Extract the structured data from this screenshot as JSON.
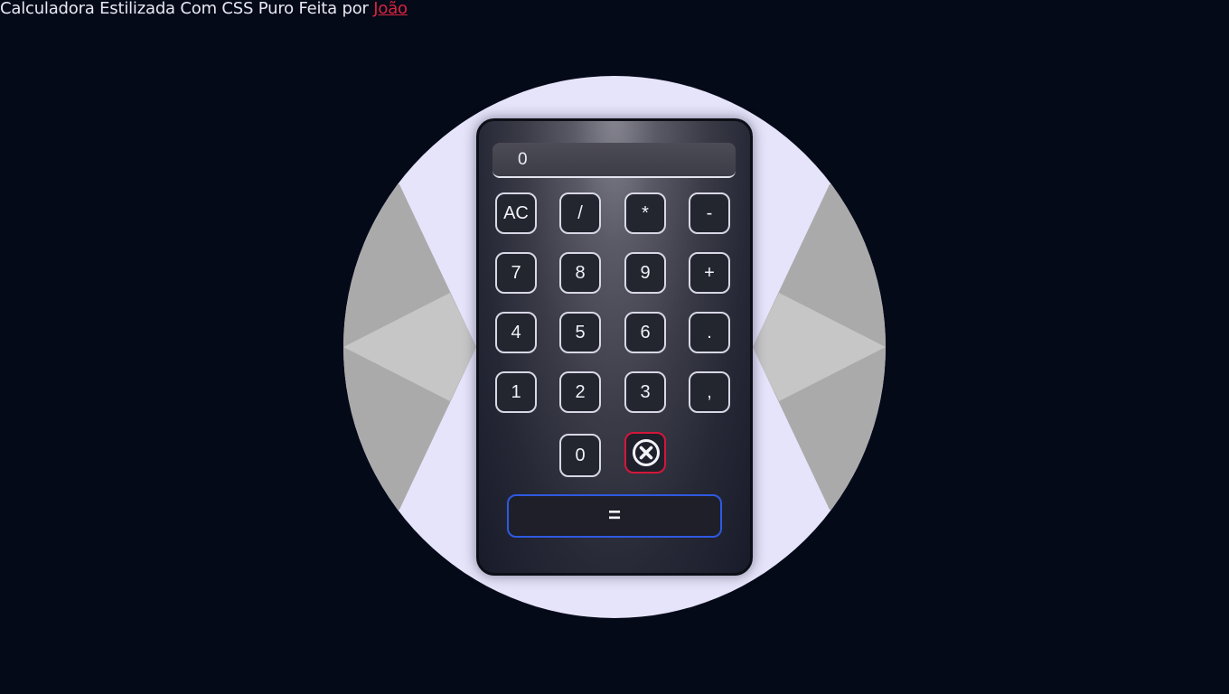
{
  "header": {
    "text": "Calculadora Estilizada Com CSS Puro Feita por ",
    "author_link": "João"
  },
  "calculator": {
    "display_value": "0",
    "row1": [
      "AC",
      "/",
      "*",
      "-"
    ],
    "row2": [
      "7",
      "8",
      "9",
      "+"
    ],
    "row3": [
      "4",
      "5",
      "6",
      "."
    ],
    "row4": [
      "1",
      "2",
      "3",
      ","
    ],
    "row5": [
      "0"
    ],
    "delete_icon": "close-circle-icon",
    "equals_label": "="
  },
  "colors": {
    "page_background": "#050a19",
    "circle": "#e6e4fa",
    "link": "#d8243e",
    "delete_border": "#d4163a",
    "equals_border": "#2e5ae2"
  }
}
